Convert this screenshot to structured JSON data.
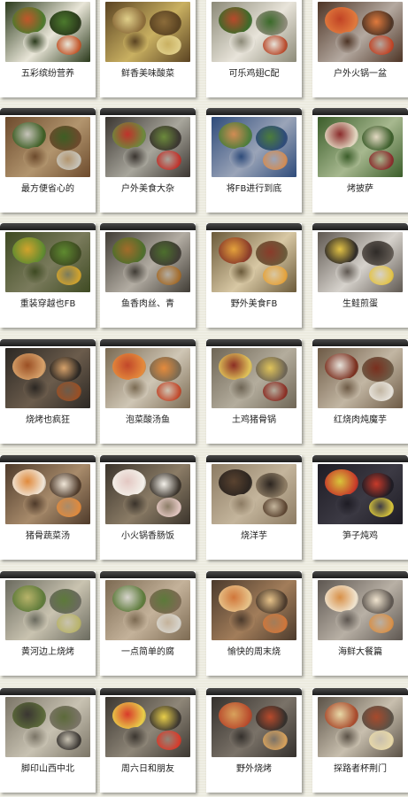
{
  "gallery": {
    "items": [
      {
        "caption": "五彩缤纷营养",
        "colors": [
          "#2b3a1c",
          "#e9e6d8",
          "#c2562a",
          "#4c7a2d"
        ]
      },
      {
        "caption": "鲜香美味酸菜",
        "colors": [
          "#5a4322",
          "#c9b061",
          "#e0cf8a",
          "#8c6c3a"
        ]
      },
      {
        "caption": "可乐鸡翅C配",
        "colors": [
          "#8c8a78",
          "#e8e4da",
          "#b8492b",
          "#3b6b2a"
        ]
      },
      {
        "caption": "户外火锅一盆",
        "colors": [
          "#4d3425",
          "#b4a9a0",
          "#c14325",
          "#e07a3d"
        ]
      },
      {
        "caption": "最方便省心的",
        "colors": [
          "#6c4a2c",
          "#b2956e",
          "#c7c4ba",
          "#3d5e24"
        ]
      },
      {
        "caption": "户外美食大杂",
        "colors": [
          "#3a3530",
          "#a8a69c",
          "#c0322b",
          "#6c8a3c"
        ]
      },
      {
        "caption": "将FB进行到底",
        "colors": [
          "#2e4b7a",
          "#9aa4b8",
          "#d28c54",
          "#4c7d3b"
        ]
      },
      {
        "caption": "烤披萨",
        "colors": [
          "#3b5d2a",
          "#a7b88f",
          "#8a2c2c",
          "#e3d9c2"
        ]
      },
      {
        "caption": "重装穿越也FB",
        "colors": [
          "#3e4a22",
          "#7a7b5c",
          "#d2a32c",
          "#5f8b30"
        ]
      },
      {
        "caption": "鱼香肉丝、青",
        "colors": [
          "#403c35",
          "#b3ada3",
          "#a36b2a",
          "#4d6f2d"
        ]
      },
      {
        "caption": "野外美食FB",
        "colors": [
          "#6b5a3a",
          "#d8c8a4",
          "#e4a23c",
          "#8a3b2a"
        ]
      },
      {
        "caption": "生鲑煎蛋",
        "colors": [
          "#5f5851",
          "#d6d2cc",
          "#e3c346",
          "#2f2b28"
        ]
      },
      {
        "caption": "烧烤也疯狂",
        "colors": [
          "#2b2723",
          "#6b5c4c",
          "#9a4f24",
          "#d7a26b"
        ]
      },
      {
        "caption": "泡菜酸汤鱼",
        "colors": [
          "#7a6a52",
          "#cfc6b5",
          "#c1472a",
          "#e58b3c"
        ]
      },
      {
        "caption": "土鸡猪骨锅",
        "colors": [
          "#6e6555",
          "#b4ad9d",
          "#8b2e24",
          "#e0c45a"
        ]
      },
      {
        "caption": "红烧肉炖魔芋",
        "colors": [
          "#6d5a45",
          "#c2b6a3",
          "#e7e3db",
          "#7a2f1e"
        ]
      },
      {
        "caption": "猪骨蔬菜汤",
        "colors": [
          "#4e3a2a",
          "#a88b6b",
          "#e08a3c",
          "#f0e6d8"
        ]
      },
      {
        "caption": "小火锅香肠饭",
        "colors": [
          "#3a332b",
          "#8b7c66",
          "#e3c7c2",
          "#f4f1ea"
        ]
      },
      {
        "caption": "烧洋芋",
        "colors": [
          "#8c7b63",
          "#c4b59c",
          "#5a4330",
          "#2c2520"
        ]
      },
      {
        "caption": "笋子炖鸡",
        "colors": [
          "#1e1c24",
          "#3c3a44",
          "#d8c53a",
          "#c83a2a"
        ]
      },
      {
        "caption": "黄河边上烧烤",
        "colors": [
          "#6a6a5e",
          "#c9c3b0",
          "#b8b36a",
          "#5d7a3a"
        ]
      },
      {
        "caption": "一点简单的腐",
        "colors": [
          "#7c6a52",
          "#c4b29a",
          "#d7d4cc",
          "#5c7a3a"
        ]
      },
      {
        "caption": "愉快的周末烧",
        "colors": [
          "#4b3a2c",
          "#a27d5a",
          "#d0763a",
          "#e7c38a"
        ]
      },
      {
        "caption": "海鲜大餐篇",
        "colors": [
          "#5d5650",
          "#b8b0a5",
          "#d89048",
          "#f0e4cf"
        ]
      },
      {
        "caption": "脚印山西中北",
        "colors": [
          "#7a7466",
          "#c8c2b2",
          "#3a3632",
          "#5c6a3a"
        ]
      },
      {
        "caption": "周六日和朋友",
        "colors": [
          "#3b3630",
          "#8e8678",
          "#d83a2a",
          "#e9cf4a"
        ]
      },
      {
        "caption": "野外烧烤",
        "colors": [
          "#34302c",
          "#7a7268",
          "#d8a25c",
          "#b84a2c"
        ]
      },
      {
        "caption": "探路者杯荆门",
        "colors": [
          "#5a5146",
          "#c8bfae",
          "#e8d9a8",
          "#a84a2c"
        ]
      }
    ]
  }
}
